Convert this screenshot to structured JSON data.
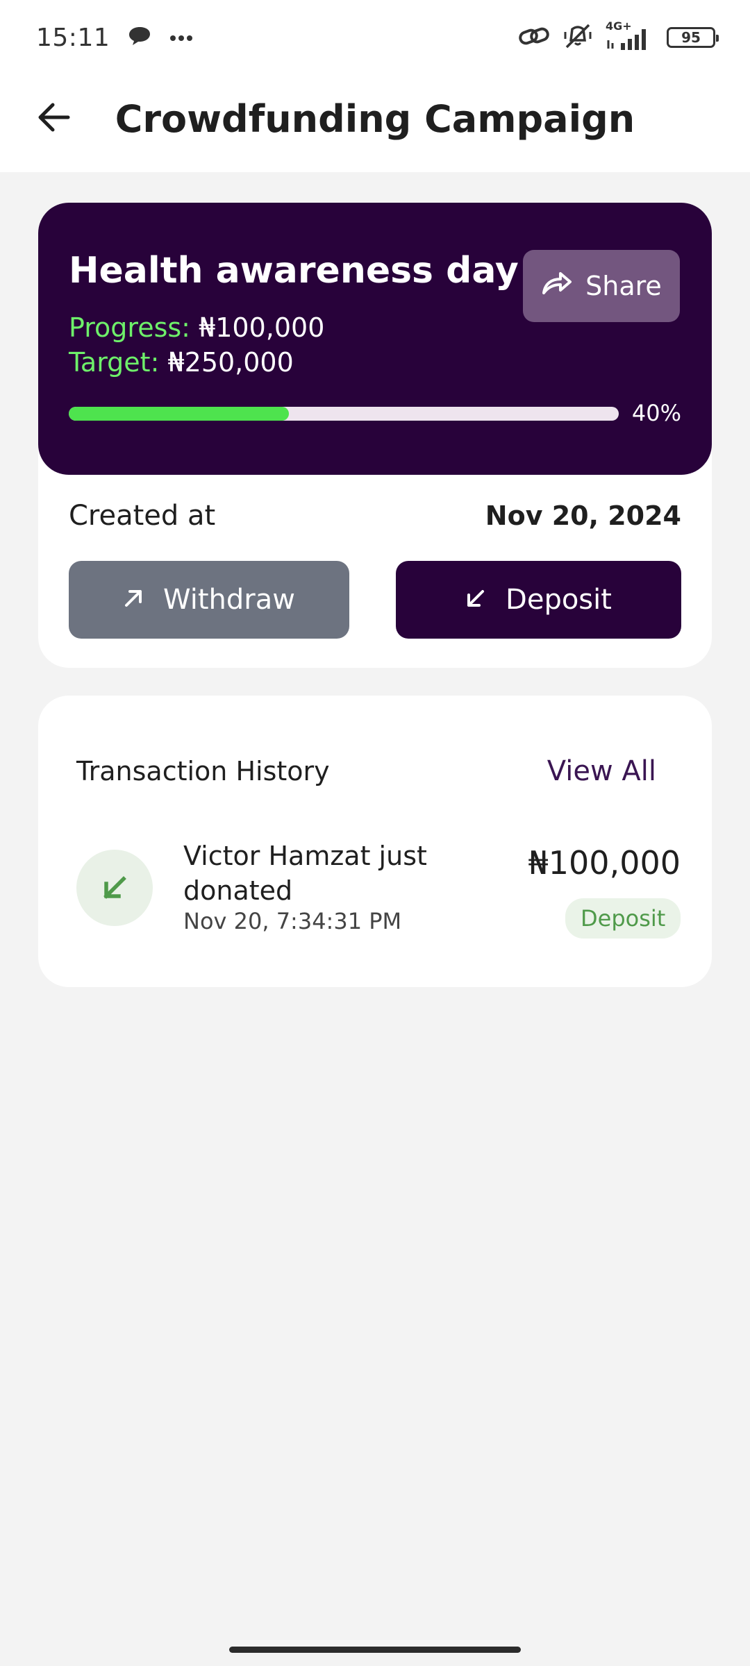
{
  "status_bar": {
    "time": "15:11",
    "network": "4G+",
    "battery": "95",
    "icons": [
      "chat-bubble-icon",
      "more-dots-icon",
      "link-icon",
      "vibrate-off-icon",
      "signal-icon",
      "battery-icon"
    ]
  },
  "header": {
    "title": "Crowdfunding Campaign",
    "back_icon": "back-arrow-icon"
  },
  "campaign": {
    "name": "Health awareness day",
    "share_label": "Share",
    "progress_label": "Progress:",
    "progress_value": "₦100,000",
    "target_label": "Target:",
    "target_value": "₦250,000",
    "progress_fraction": 0.4,
    "progress_percent_text": "40%",
    "created_label": "Created at",
    "created_date": "Nov 20, 2024",
    "withdraw_label": "Withdraw",
    "deposit_label": "Deposit"
  },
  "transactions": {
    "title": "Transaction History",
    "view_all_label": "View All",
    "items": [
      {
        "description": "Victor Hamzat just donated",
        "time": "Nov 20, 7:34:31 PM",
        "amount": "₦100,000",
        "type": "Deposit"
      }
    ]
  },
  "colors": {
    "brand_dark": "#28023a",
    "share_button": "#73567f",
    "accent_green": "#4ee34e",
    "label_green": "#6ef06a",
    "withdraw_button": "#6d7380",
    "deposit_badge_text": "#4f9a4a",
    "background": "#f3f3f3"
  }
}
